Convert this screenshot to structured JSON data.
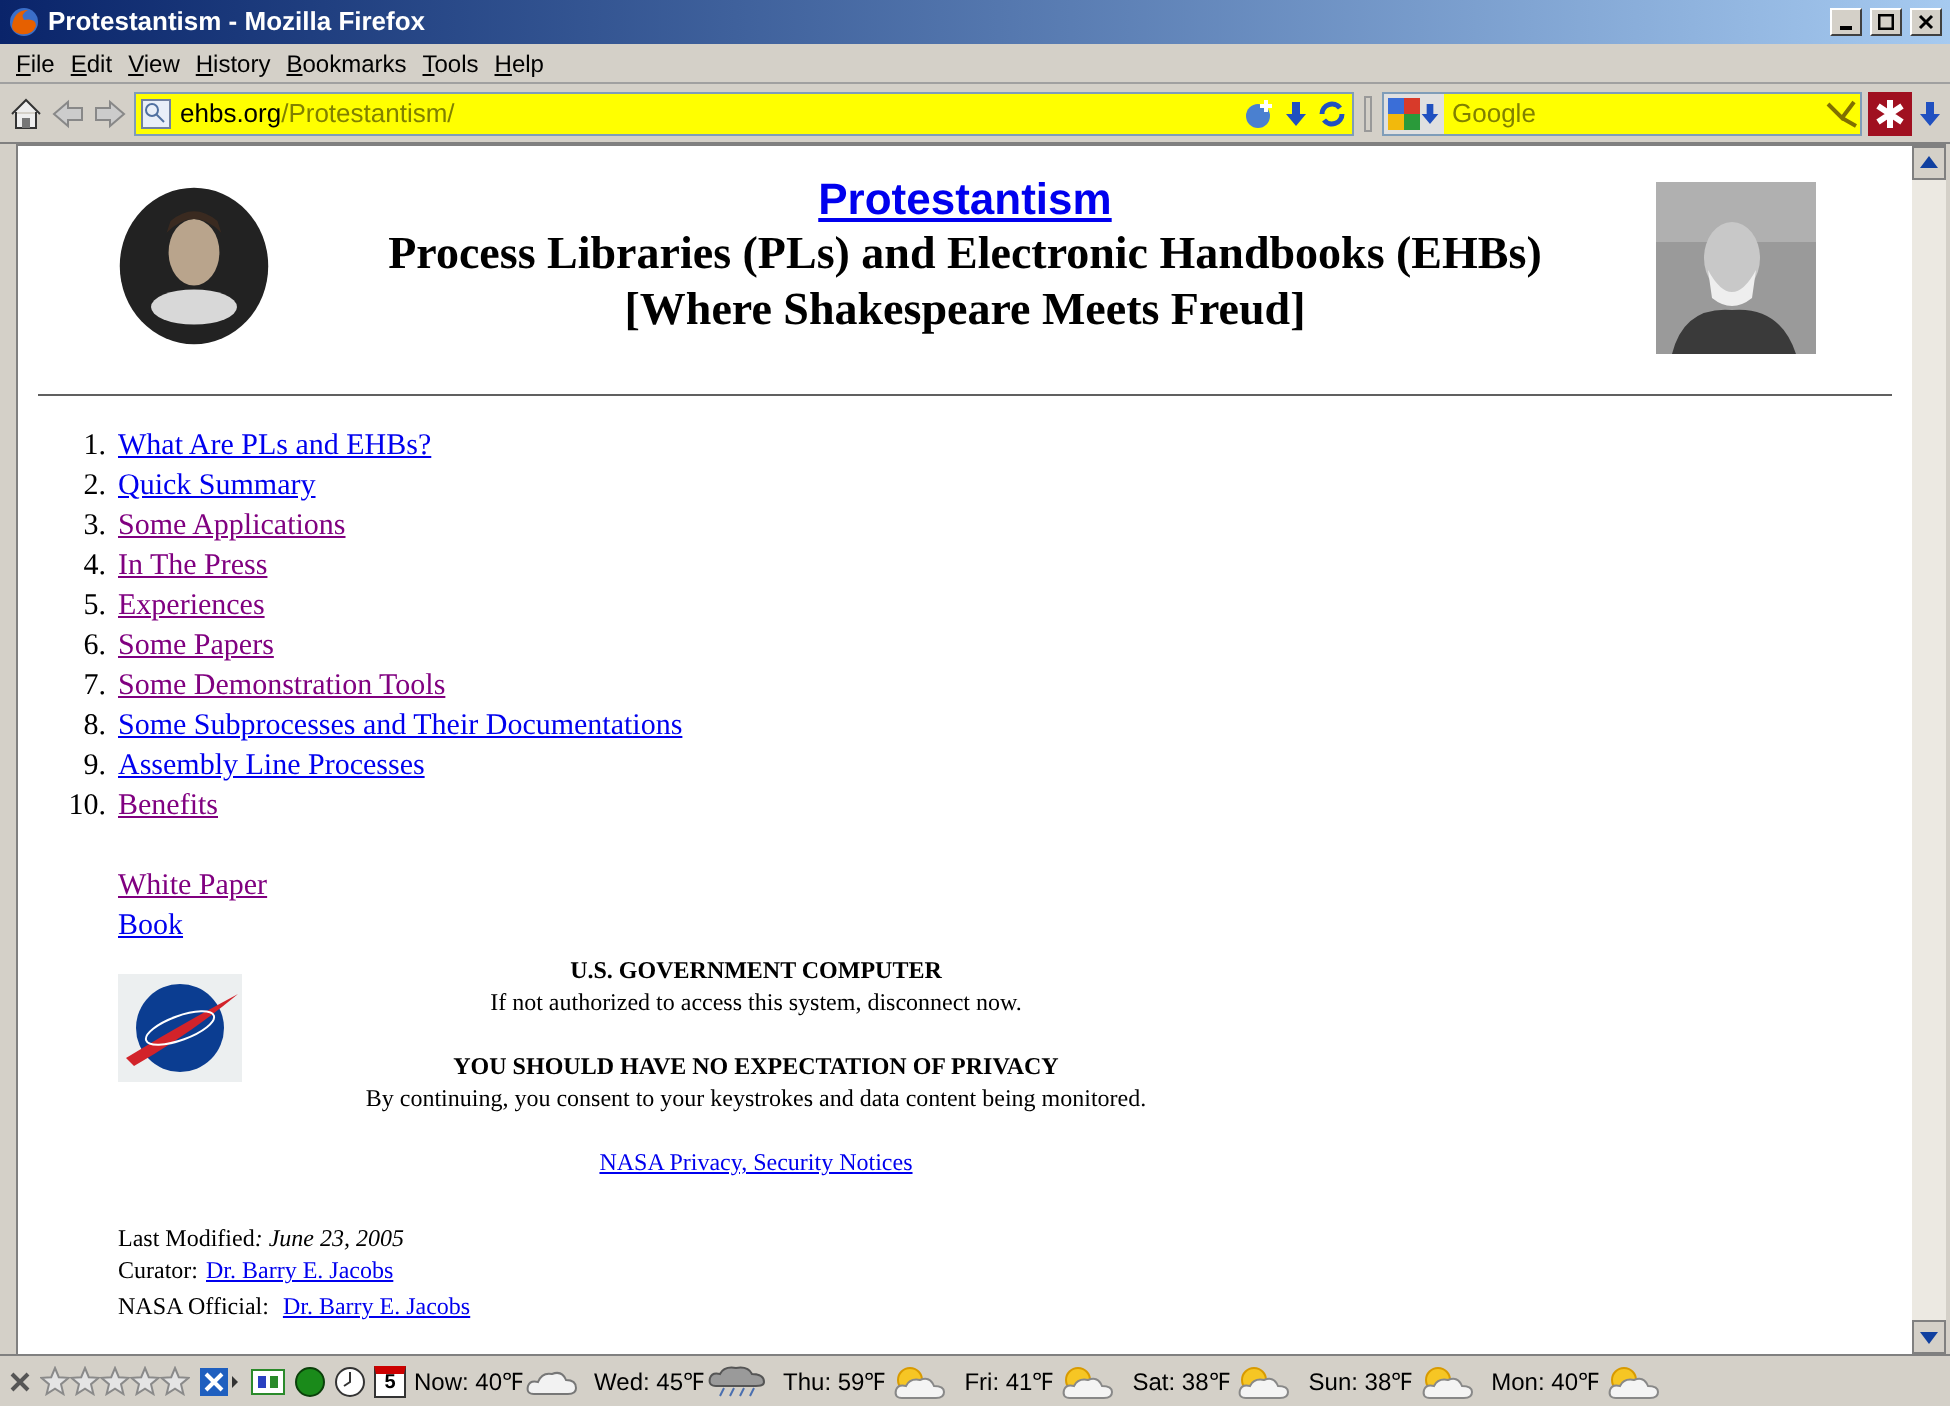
{
  "window": {
    "title": "Protestantism - Mozilla Firefox"
  },
  "menu": [
    "File",
    "Edit",
    "View",
    "History",
    "Bookmarks",
    "Tools",
    "Help"
  ],
  "address": {
    "domain": "ehbs.org",
    "path": "/Protestantism/"
  },
  "search": {
    "placeholder": "Google"
  },
  "page": {
    "title": "Protestantism",
    "subtitle": "Process Libraries (PLs) and Electronic Handbooks (EHBs)",
    "tagline": "[Where Shakespeare Meets Freud]",
    "contents": [
      {
        "number": "1.",
        "label": "What Are PLs and EHBs?",
        "visited": false
      },
      {
        "number": "2.",
        "label": "Quick Summary",
        "visited": false
      },
      {
        "number": "3.",
        "label": "Some Applications",
        "visited": true
      },
      {
        "number": "4.",
        "label": "In The Press",
        "visited": true
      },
      {
        "number": "5.",
        "label": "Experiences",
        "visited": true
      },
      {
        "number": "6.",
        "label": "Some Papers",
        "visited": true
      },
      {
        "number": "7.",
        "label": "Some Demonstration Tools",
        "visited": true
      },
      {
        "number": "8.",
        "label": "Some Subprocesses and Their Documentations",
        "visited": false
      },
      {
        "number": "9.",
        "label": "Assembly Line Processes",
        "visited": false
      },
      {
        "number": "10.",
        "label": "Benefits",
        "visited": true
      }
    ],
    "extra_links": [
      {
        "label": "White Paper",
        "visited": true
      },
      {
        "label": "Book",
        "visited": false
      }
    ],
    "notice": {
      "heading": "U.S. GOVERNMENT COMPUTER",
      "line": "If not authorized to access this system, disconnect now.",
      "heading2": "YOU SHOULD HAVE NO EXPECTATION OF PRIVACY",
      "line2": "By continuing, you consent to your keystrokes and data content being monitored.",
      "link": "NASA Privacy, Security Notices"
    },
    "footer": {
      "modified_label": "Last Modified",
      "modified_date": ": June 23, 2005",
      "curator_label": "Curator:",
      "curator": "Dr. Barry E. Jacobs",
      "official_label": "NASA Official:",
      "official": "Dr. Barry E. Jacobs"
    }
  },
  "status_bar": {
    "stars": 0,
    "calendar_day": "5",
    "weather": [
      {
        "label": "Now: 40℉",
        "kind": "cloudy"
      },
      {
        "label": "Wed: 45℉",
        "kind": "rain"
      },
      {
        "label": "Thu: 59℉",
        "kind": "partly"
      },
      {
        "label": "Fri: 41℉",
        "kind": "partly"
      },
      {
        "label": "Sat: 38℉",
        "kind": "partly"
      },
      {
        "label": "Sun: 38℉",
        "kind": "partly"
      },
      {
        "label": "Mon: 40℉",
        "kind": "partly"
      }
    ]
  }
}
